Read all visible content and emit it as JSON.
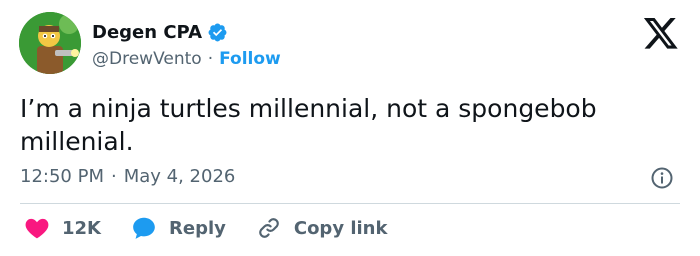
{
  "author": {
    "display_name": "Degen CPA",
    "handle": "@DrewVento",
    "separator": "·",
    "follow_label": "Follow",
    "verified": true
  },
  "tweet": {
    "text": "I’m a ninja turtles millennial, not a spongebob millenial.",
    "time": "12:50 PM",
    "meta_separator": "·",
    "date": "May 4, 2026"
  },
  "actions": {
    "like_count": "12K",
    "reply_label": "Reply",
    "copy_link_label": "Copy link"
  },
  "colors": {
    "accent": "#1d9bf0",
    "like": "#f91880",
    "text": "#0f1419",
    "muted": "#536471",
    "divider": "#cfd9de"
  },
  "icons": [
    "avatar-image",
    "verified-badge-icon",
    "x-logo-icon",
    "info-icon",
    "heart-icon",
    "reply-bubble-icon",
    "link-icon"
  ]
}
